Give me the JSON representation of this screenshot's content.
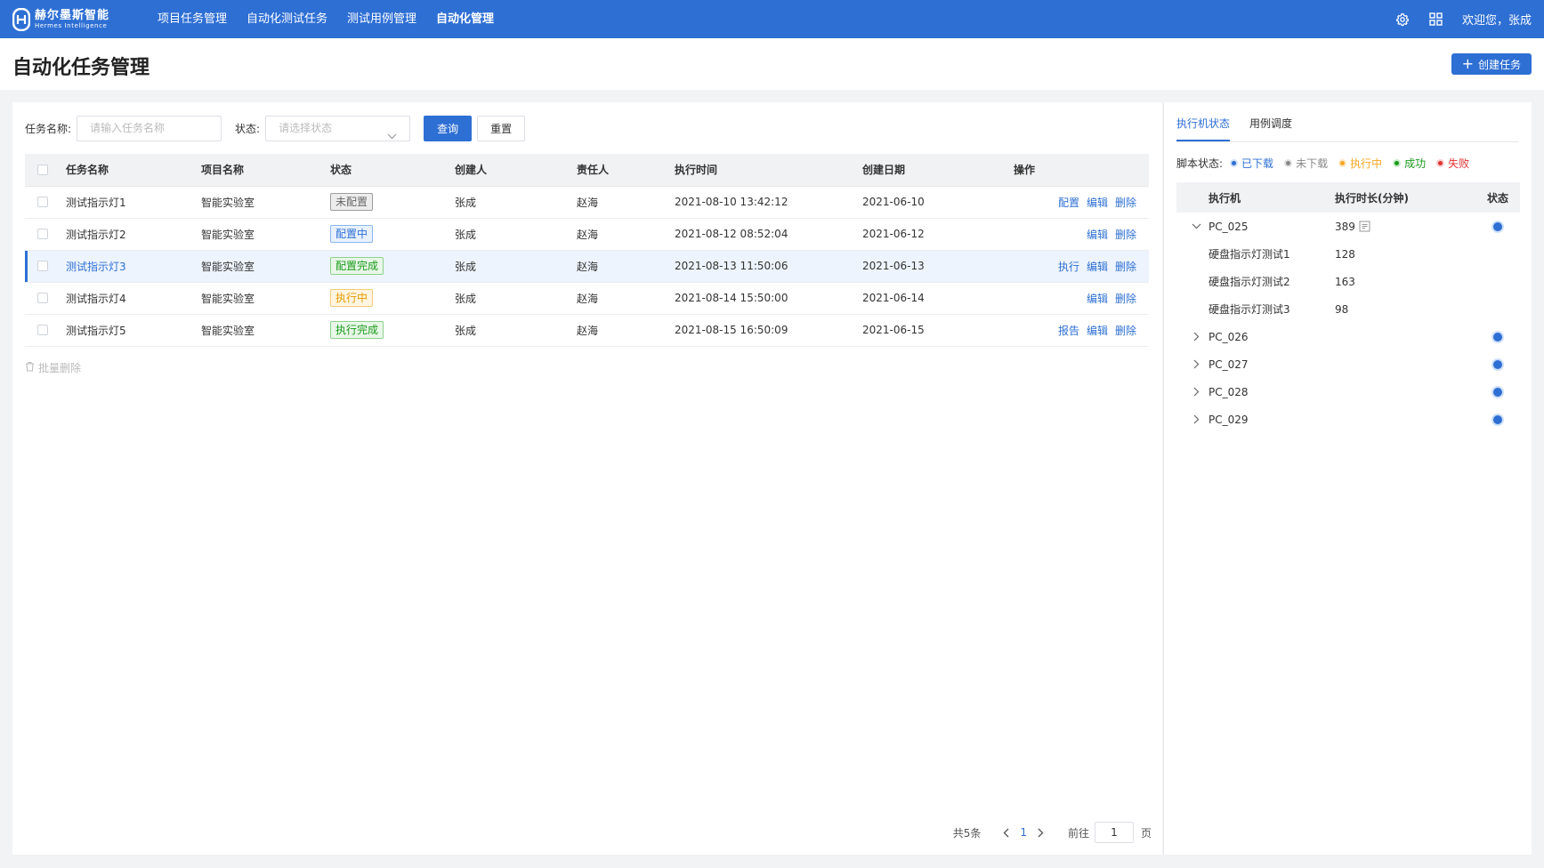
{
  "header": {
    "logo_cn": "赫尔墨斯智能",
    "logo_en": "Hermes Intelligence",
    "nav": [
      {
        "label": "项目任务管理"
      },
      {
        "label": "自动化测试任务"
      },
      {
        "label": "测试用例管理"
      },
      {
        "label": "自动化管理"
      }
    ],
    "active_nav": "自动化管理",
    "welcome": "欢迎您，张成"
  },
  "page": {
    "title": "自动化任务管理",
    "create_button": "创建任务"
  },
  "filter": {
    "name_label": "任务名称:",
    "name_placeholder": "请输入任务名称",
    "status_label": "状态:",
    "status_placeholder": "请选择状态",
    "query_button": "查询",
    "reset_button": "重置"
  },
  "table": {
    "columns": [
      "任务名称",
      "项目名称",
      "状态",
      "创建人",
      "责任人",
      "执行时间",
      "创建日期",
      "操作"
    ],
    "rows": [
      {
        "name": "测试指示灯1",
        "project": "智能实验室",
        "status": "未配置",
        "status_color": "gray",
        "creator": "张成",
        "owner": "赵海",
        "exec_time": "2021-08-10  13:42:12",
        "created": "2021-06-10",
        "ops": [
          "配置",
          "编辑",
          "删除"
        ]
      },
      {
        "name": "测试指示灯2",
        "project": "智能实验室",
        "status": "配置中",
        "status_color": "blue",
        "creator": "张成",
        "owner": "赵海",
        "exec_time": "2021-08-12  08:52:04",
        "created": "2021-06-12",
        "ops": [
          "编辑",
          "删除"
        ]
      },
      {
        "name": "测试指示灯3",
        "project": "智能实验室",
        "status": "配置完成",
        "status_color": "green",
        "creator": "张成",
        "owner": "赵海",
        "exec_time": "2021-08-13  11:50:06",
        "created": "2021-06-13",
        "ops": [
          "执行",
          "编辑",
          "删除"
        ],
        "selected": true
      },
      {
        "name": "测试指示灯4",
        "project": "智能实验室",
        "status": "执行中",
        "status_color": "orange",
        "creator": "张成",
        "owner": "赵海",
        "exec_time": "2021-08-14  15:50:00",
        "created": "2021-06-14",
        "ops": [
          "编辑",
          "删除"
        ]
      },
      {
        "name": "测试指示灯5",
        "project": "智能实验室",
        "status": "执行完成",
        "status_color": "green",
        "creator": "张成",
        "owner": "赵海",
        "exec_time": "2021-08-15  16:50:09",
        "created": "2021-06-15",
        "ops": [
          "报告",
          "编辑",
          "删除"
        ]
      }
    ],
    "batch_delete": "批量删除"
  },
  "pagination": {
    "total": "共5条",
    "current": "1",
    "goto_label": "前往",
    "goto_value": "1",
    "page_suffix": "页"
  },
  "side": {
    "tabs": [
      "执行机状态",
      "用例调度"
    ],
    "active_tab": "执行机状态",
    "legend_label": "脚本状态:",
    "legend": [
      {
        "label": "已下载",
        "color": "#2e6fd4"
      },
      {
        "label": "未下载",
        "color": "#888888"
      },
      {
        "label": "执行中",
        "color": "#f5a623"
      },
      {
        "label": "成功",
        "color": "#1a9a1a"
      },
      {
        "label": "失败",
        "color": "#e03131"
      }
    ],
    "columns": [
      "执行机",
      "执行时长(分钟)",
      "状态"
    ],
    "machines": [
      {
        "name": "PC_025",
        "duration": "389",
        "expanded": true,
        "children": [
          {
            "name": "硬盘指示灯测试1",
            "duration": "128"
          },
          {
            "name": "硬盘指示灯测试2",
            "duration": "163"
          },
          {
            "name": "硬盘指示灯测试3",
            "duration": "98"
          }
        ]
      },
      {
        "name": "PC_026",
        "duration": "",
        "expanded": false,
        "children": []
      },
      {
        "name": "PC_027",
        "duration": "",
        "expanded": false,
        "children": []
      },
      {
        "name": "PC_028",
        "duration": "",
        "expanded": false,
        "children": []
      },
      {
        "name": "PC_029",
        "duration": "",
        "expanded": false,
        "children": []
      }
    ]
  }
}
